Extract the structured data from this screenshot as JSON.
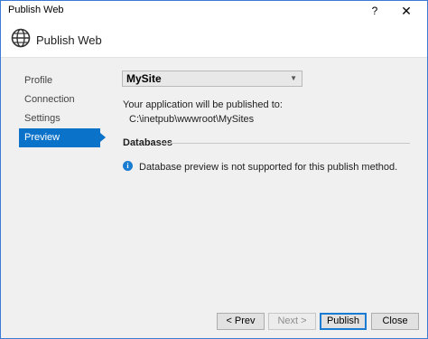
{
  "window": {
    "title": "Publish Web",
    "help_glyph": "?",
    "close_glyph": "✕"
  },
  "header": {
    "title": "Publish Web",
    "icon": "globe-icon"
  },
  "sidebar": {
    "items": [
      {
        "label": "Profile"
      },
      {
        "label": "Connection"
      },
      {
        "label": "Settings"
      },
      {
        "label": "Preview",
        "selected": true
      }
    ]
  },
  "main": {
    "profile_select": {
      "value": "MySite"
    },
    "publish_label": "Your application will be published to:",
    "publish_path": "C:\\inetpub\\wwwroot\\MySites",
    "databases": {
      "header": "Databases",
      "info_text": "Database preview is not supported for this publish method."
    }
  },
  "footer": {
    "prev_label": "< Prev",
    "next_label": "Next >",
    "publish_label": "Publish",
    "close_label": "Close"
  },
  "colors": {
    "accent": "#0a72c8",
    "info": "#1a7cd1",
    "window_border": "#3a7bd5"
  }
}
